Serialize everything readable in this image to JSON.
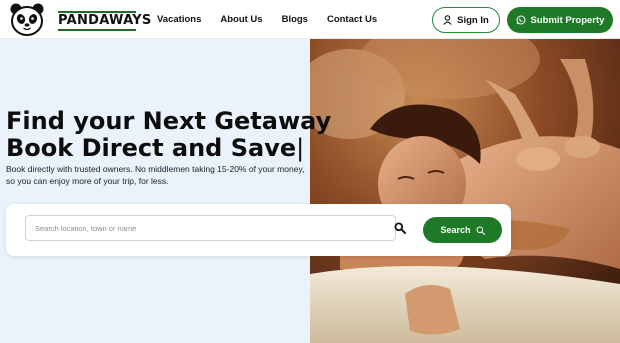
{
  "brand": {
    "name": "PANDAWAYS",
    "accent": "#1e7a26"
  },
  "nav": {
    "items": [
      {
        "label": "Vacations"
      },
      {
        "label": "About Us"
      },
      {
        "label": "Blogs"
      },
      {
        "label": "Contact Us"
      }
    ]
  },
  "header": {
    "signin_label": "Sign In",
    "submit_label": "Submit Property",
    "signin_icon": "user-icon",
    "submit_icon": "whatsapp-icon"
  },
  "hero": {
    "headline_line1": "Find your Next Getaway",
    "headline_line2": "Book Direct and Save",
    "cursor": "|",
    "subtext_line1": "Book directly with trusted owners. No middlemen taking 15-20% of your money,",
    "subtext_line2": "so you can enjoy more of your trip, for less."
  },
  "search": {
    "placeholder": "Search location, town or name",
    "value": "",
    "button_label": "Search"
  }
}
